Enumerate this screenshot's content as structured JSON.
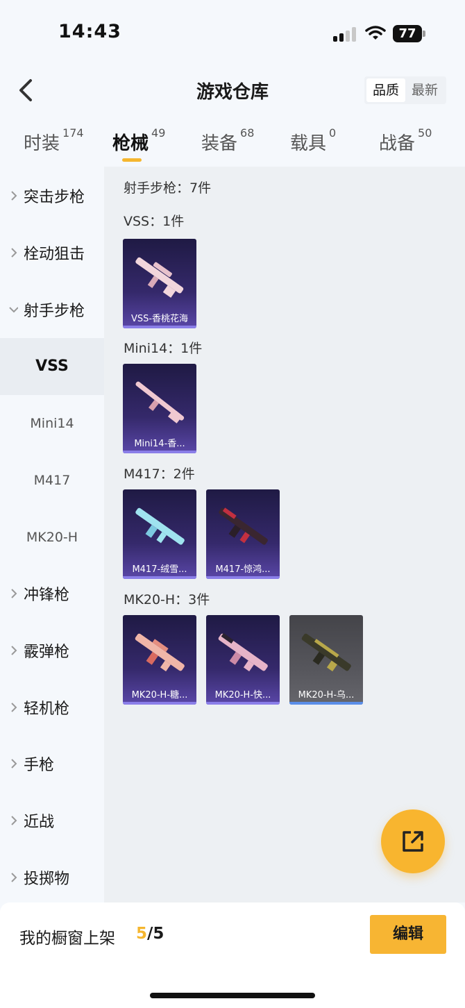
{
  "status": {
    "time": "14:43",
    "battery": "77"
  },
  "header": {
    "title": "游戏仓库",
    "sort_quality": "品质",
    "sort_newest": "最新"
  },
  "tabs": [
    {
      "label": "时装",
      "count": "174"
    },
    {
      "label": "枪械",
      "count": "49"
    },
    {
      "label": "装备",
      "count": "68"
    },
    {
      "label": "载具",
      "count": "0"
    },
    {
      "label": "战备",
      "count": "50"
    }
  ],
  "sidebar": {
    "assault": "突击步枪",
    "bolt": "栓动狙击",
    "dmr": "射手步枪",
    "sub_vss": "VSS",
    "sub_mini14": "Mini14",
    "sub_m417": "M417",
    "sub_mk20": "MK20-H",
    "smg": "冲锋枪",
    "shotgun": "霰弹枪",
    "lmg": "轻机枪",
    "pistol": "手枪",
    "melee": "近战",
    "throw": "投掷物"
  },
  "content": {
    "category_head": "射手步枪：7件",
    "vss_head": "VSS：1件",
    "vss_items": [
      "VSS-香桃花海"
    ],
    "mini14_head": "Mini14：1件",
    "mini14_items": [
      "Mini14-香..."
    ],
    "m417_head": "M417：2件",
    "m417_items": [
      "M417-绒雪...",
      "M417-惊鸿..."
    ],
    "mk20_head": "MK20-H：3件",
    "mk20_items": [
      "MK20-H-糖...",
      "MK20-H-快...",
      "MK20-H-乌..."
    ]
  },
  "footer": {
    "label": "我的橱窗上架",
    "current": "5",
    "sep": "/",
    "max": "5",
    "edit": "编辑"
  },
  "colors": {
    "accent": "#f5b62f",
    "card_purple": "#35296b",
    "card_gray": "#56565c"
  },
  "icons": [
    "back-arrow-icon",
    "chevron-right-icon",
    "chevron-down-icon",
    "share-edit-icon",
    "signal-icon",
    "wifi-icon",
    "battery-icon"
  ]
}
